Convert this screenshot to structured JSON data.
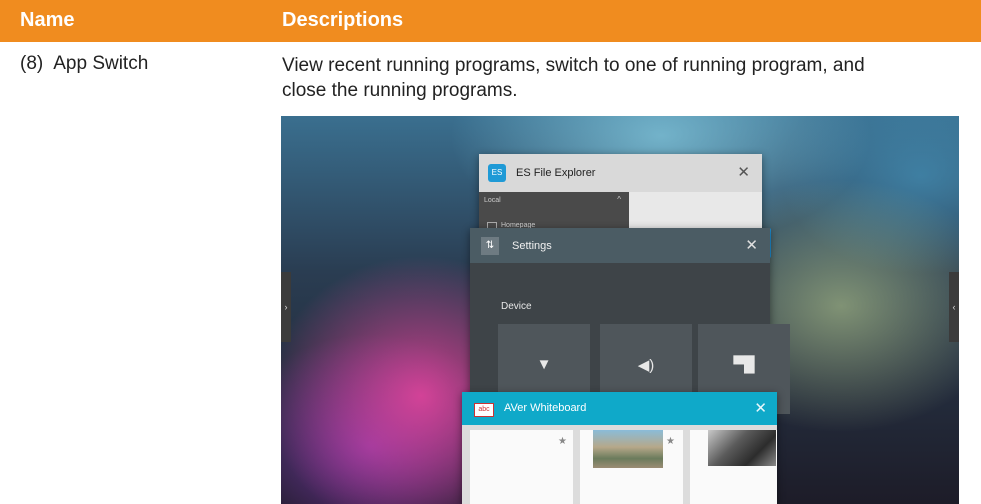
{
  "table": {
    "header": {
      "name": "Name",
      "descriptions": "Descriptions"
    },
    "row": {
      "number": "(8)",
      "name": "App Switch",
      "description": "View recent running programs, switch to one of running program, and close the running programs."
    }
  },
  "screenshot": {
    "left_tab_glyph": "›",
    "right_tab_glyph": "‹",
    "cards": {
      "es_file_explorer": {
        "title": "ES File Explorer",
        "icon_text": "ES",
        "close": "✕",
        "sidebar_header": "Local",
        "sidebar_caret": "^",
        "sidebar_item": "Homepage"
      },
      "settings": {
        "title": "Settings",
        "icon_text": "⇅",
        "close": "✕",
        "section": "Device",
        "tiles": [
          {
            "icon": "wifi-icon",
            "glyph": "▼"
          },
          {
            "icon": "sound-icon",
            "glyph": "◀)"
          },
          {
            "icon": "android-icon",
            "glyph": "▀█"
          }
        ]
      },
      "aver_whiteboard": {
        "title": "AVer Whiteboard",
        "icon_text": "abc",
        "close": "✕",
        "star": "★"
      }
    }
  },
  "colors": {
    "header": "#f08c1f",
    "aver_bar": "#0fa9c9",
    "es_icon": "#1f9ad6"
  }
}
